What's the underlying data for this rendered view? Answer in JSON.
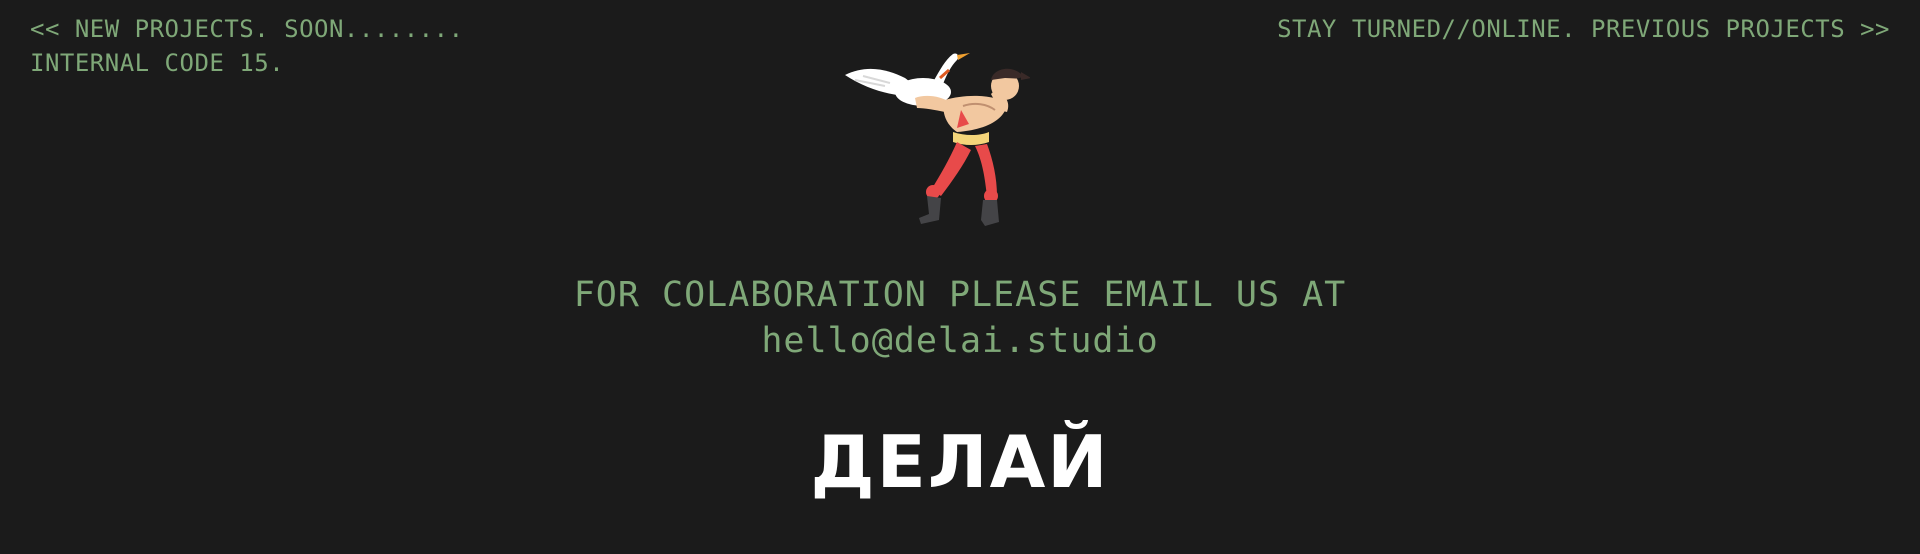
{
  "nav": {
    "left_line1": "<< NEW PROJECTS. SOON........",
    "left_line2": "INTERNAL CODE 15.",
    "right_line1": "STAY TURNED//ONLINE. PREVIOUS PROJECTS >>"
  },
  "mascot": {
    "icon": "man-wrestling-goose-illustration"
  },
  "contact": {
    "line1": "FOR COLABORATION PLEASE EMAIL US AT",
    "email": "hello@delai.studio"
  },
  "brand": {
    "logo_text": "ДЕЛАЙ"
  },
  "colors": {
    "background": "#1b1b1b",
    "accent_green": "#7fa878",
    "logo_white": "#ffffff"
  }
}
